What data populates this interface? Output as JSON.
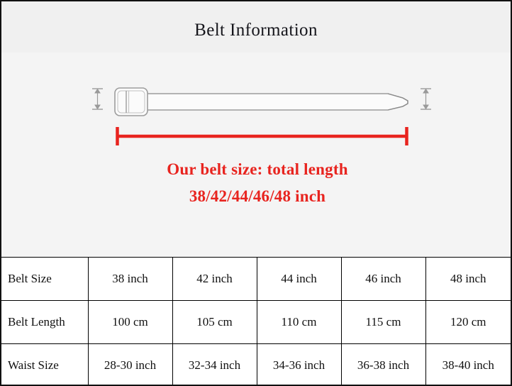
{
  "header": {
    "title": "Belt Information"
  },
  "illustration": {
    "name": "belt-diagram",
    "caption_line1": "Our belt size: total length",
    "caption_line2": "38/42/44/46/48 inch",
    "caption_color": "#e8241f",
    "measure_line_color": "#e8241f",
    "belt_outline_color": "#8a8a8a",
    "dimension_arrow_color": "#9a9a9a",
    "parts": [
      "belt-buckle",
      "belt-strap",
      "belt-tip",
      "left-height-arrow",
      "right-height-arrow",
      "total-length-measure-line"
    ]
  },
  "table": {
    "rows": [
      {
        "label": "Belt Size",
        "values": [
          "38 inch",
          "42 inch",
          "44 inch",
          "46 inch",
          "48 inch"
        ]
      },
      {
        "label": "Belt Length",
        "values": [
          "100 cm",
          "105 cm",
          "110 cm",
          "115 cm",
          "120 cm"
        ]
      },
      {
        "label": "Waist Size",
        "values": [
          "28-30 inch",
          "32-34 inch",
          "34-36 inch",
          "36-38 inch",
          "38-40 inch"
        ]
      }
    ]
  },
  "colors": {
    "page_background": "#f4f4f4",
    "header_background": "#f0f0f0",
    "table_background": "#ffffff",
    "border": "#111111",
    "accent_red": "#e8241f",
    "text": "#15151b"
  }
}
